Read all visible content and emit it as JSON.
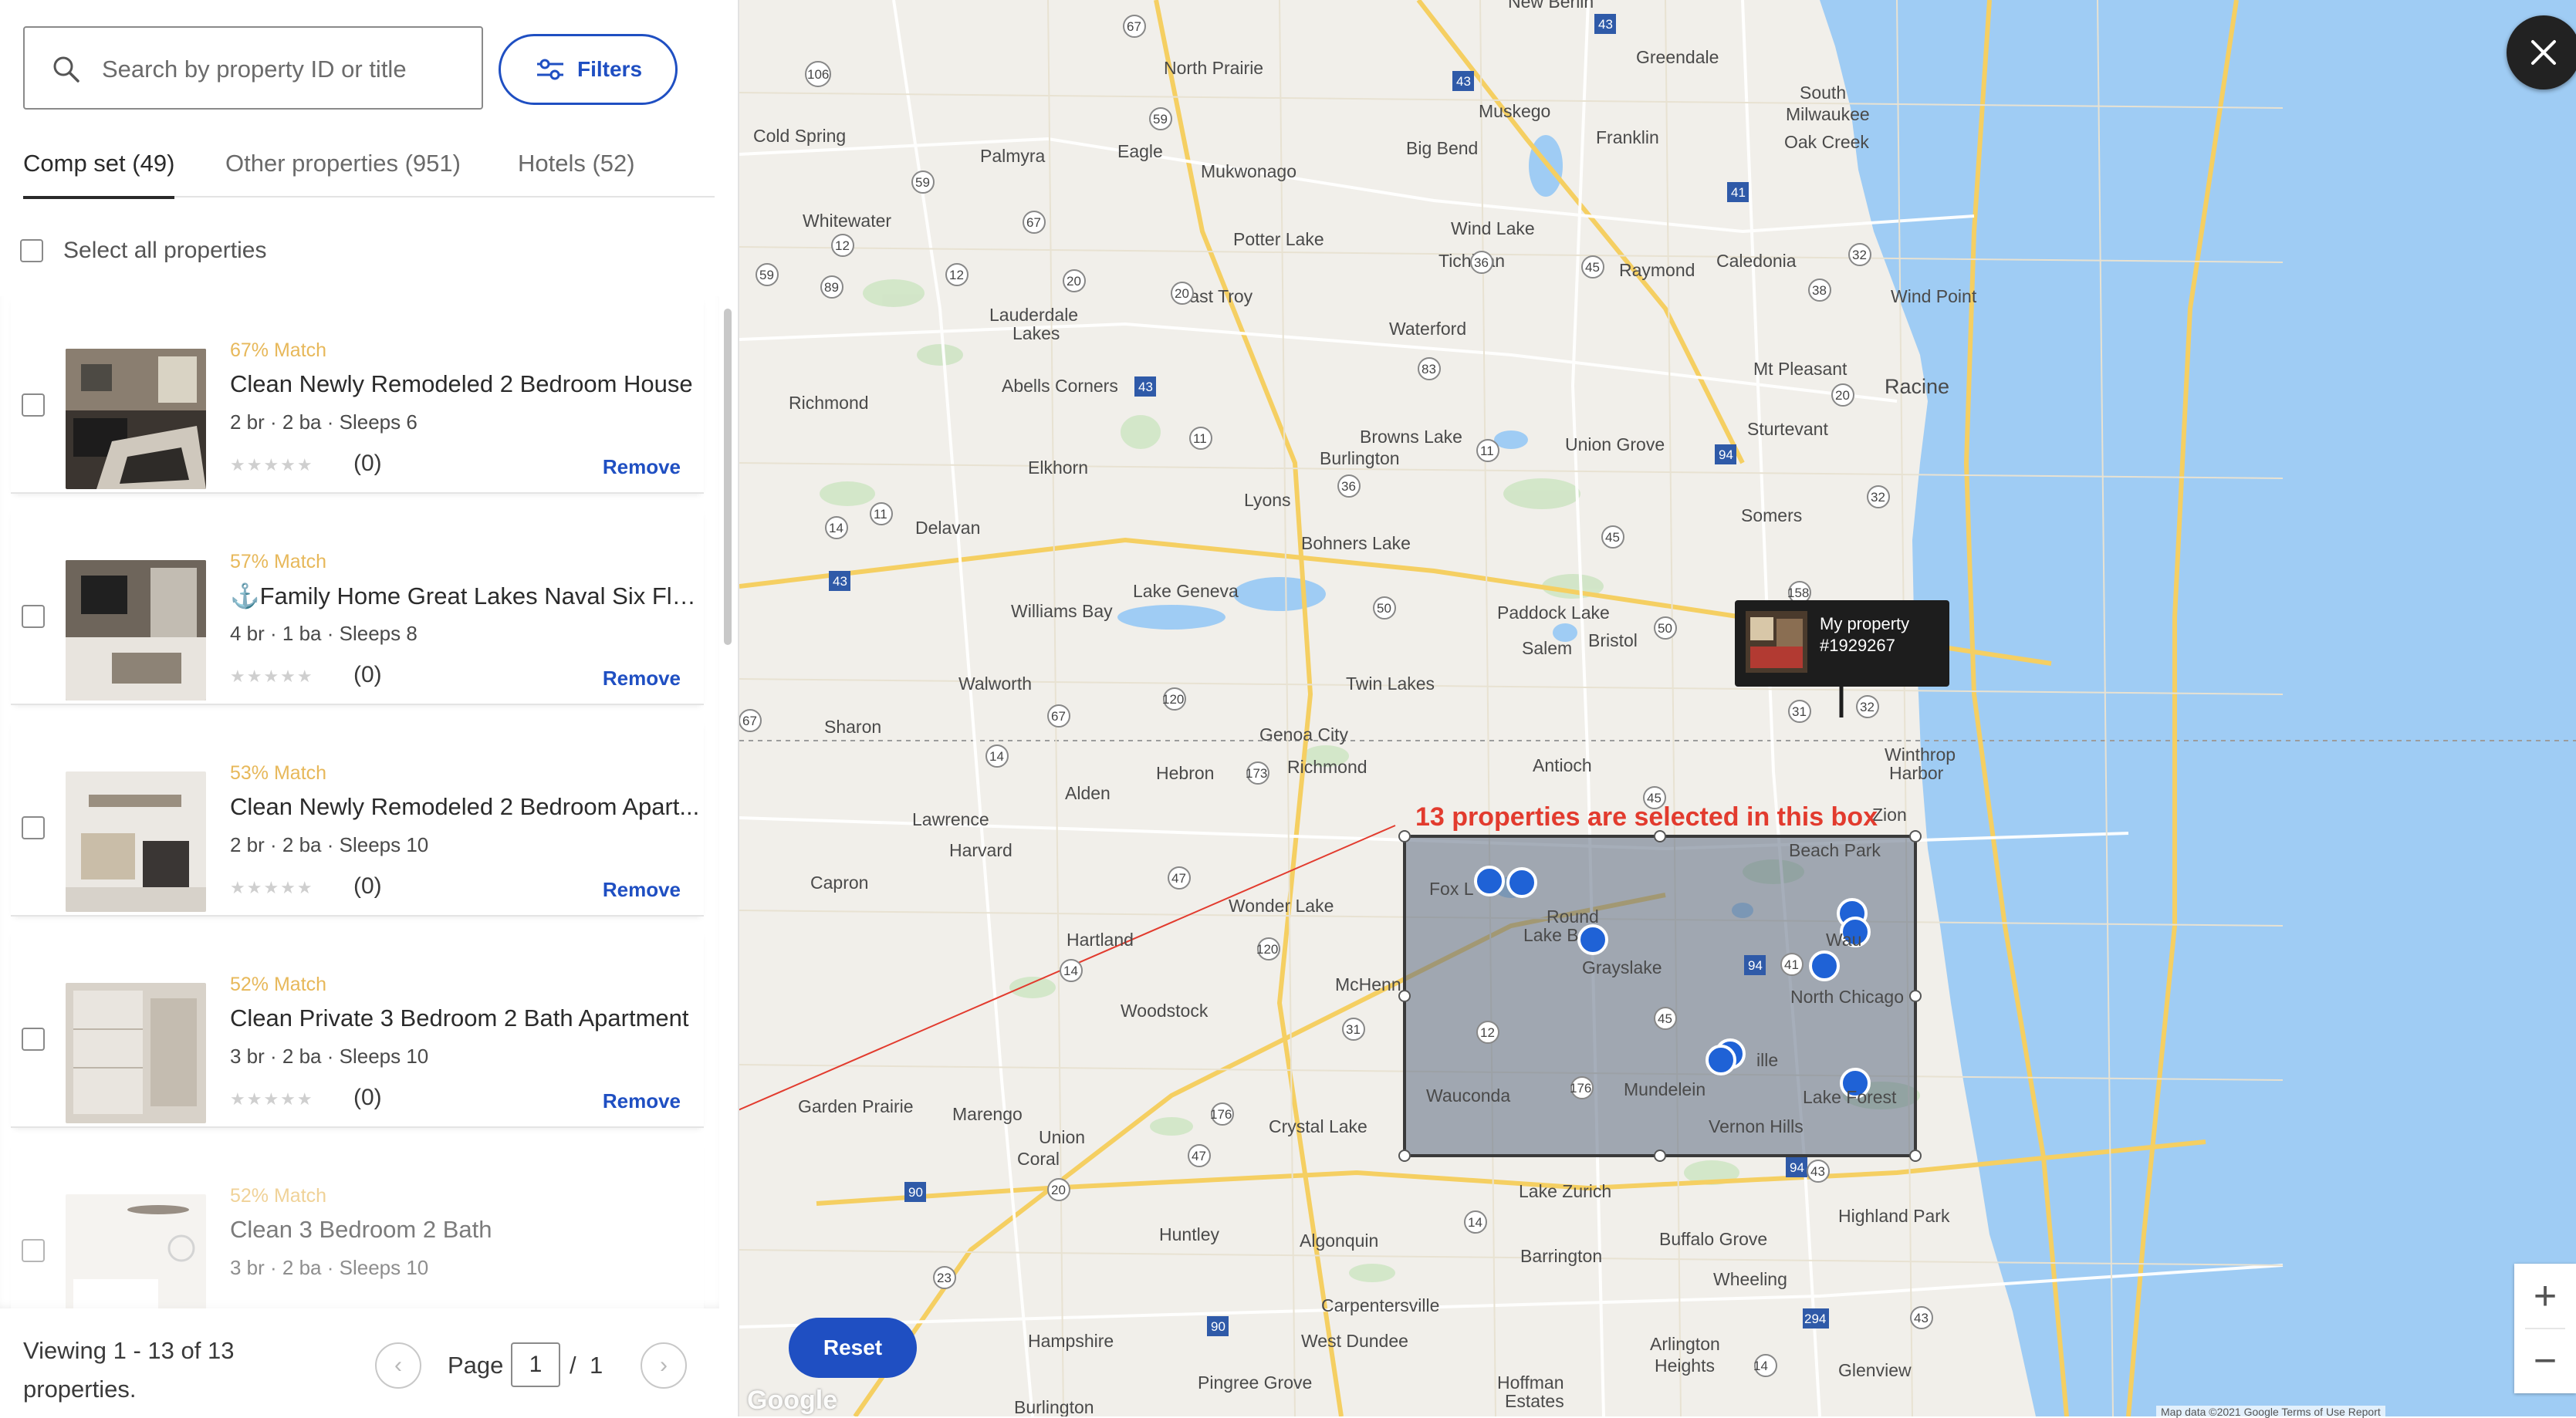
{
  "search": {
    "placeholder": "Search by property ID or title"
  },
  "filters": {
    "label": "Filters"
  },
  "tabs": [
    {
      "label": "Comp set (49)",
      "active": true
    },
    {
      "label": "Other properties (951)",
      "active": false
    },
    {
      "label": "Hotels (52)",
      "active": false
    }
  ],
  "select_all": {
    "label": "Select all properties"
  },
  "listings": [
    {
      "match": "67% Match",
      "title": "Clean Newly Remodeled 2 Bedroom House",
      "details": "2 br · 2 ba · Sleeps 6",
      "reviews": "(0)",
      "action": "Remove"
    },
    {
      "match": "57% Match",
      "title": "⚓Family Home Great Lakes Naval Six Flag...",
      "details": "4 br · 1 ba · Sleeps 8",
      "reviews": "(0)",
      "action": "Remove"
    },
    {
      "match": "53% Match",
      "title": "Clean Newly Remodeled 2 Bedroom Apart...",
      "details": "2 br · 2 ba · Sleeps 10",
      "reviews": "(0)",
      "action": "Remove"
    },
    {
      "match": "52% Match",
      "title": "Clean Private 3 Bedroom 2 Bath Apartment",
      "details": "3 br · 2 ba · Sleeps 10",
      "reviews": "(0)",
      "action": "Remove"
    },
    {
      "match": "52% Match",
      "title": "Clean 3 Bedroom 2 Bath",
      "details": "3 br · 2 ba · Sleeps 10",
      "reviews": "",
      "action": ""
    }
  ],
  "pagination": {
    "viewing": "Viewing 1 - 13 of 13 properties.",
    "page_label": "Page",
    "current_page": "1",
    "separator": "/",
    "total_pages": "1"
  },
  "map": {
    "reset_label": "Reset",
    "zoom_in": "+",
    "zoom_out": "−",
    "annotation": "13 properties are selected in this box",
    "popup": {
      "line1": "My property",
      "line2": "#1929267"
    },
    "google": "Google",
    "copyright": "Map data ©2021 Google   Terms of Use   Report",
    "places": [
      "North Prairie",
      "Greendale",
      "South Milwaukee",
      "Oak Creek",
      "Muskego",
      "Franklin",
      "Cold Spring",
      "Palmyra",
      "Eagle",
      "Big Bend",
      "Mukwonago",
      "Wind Lake",
      "Tichigan",
      "Raymond",
      "Caledonia",
      "Whitewater",
      "Potter Lake",
      "Wind Point",
      "East Troy",
      "Lauderdale Lakes",
      "Waterford",
      "Mt Pleasant",
      "Racine",
      "Abells Corners",
      "Richmond",
      "Sturtevant",
      "Browns Lake",
      "Burlington",
      "Union Grove",
      "Elkhorn",
      "Lyons",
      "Somers",
      "Delavan",
      "Bohners Lake",
      "Lake Geneva",
      "Williams Bay",
      "Paddock Lake",
      "Salem",
      "Bristol",
      "Twin Lakes",
      "Walworth",
      "Sharon",
      "Genoa City",
      "Winthrop Harbor",
      "Antioch",
      "Hebron",
      "Richmond",
      "Alden",
      "Lawrence",
      "Harvard",
      "Zion",
      "Beach Park",
      "Capron",
      "Fox Lake",
      "Round Lake Beach",
      "Waukegan",
      "Grayslake",
      "Wonder Lake",
      "Hartland",
      "North Chicago",
      "McHenry",
      "Libertyville",
      "Woodstock",
      "Wauconda",
      "Mundelein",
      "Lake Forest",
      "Garden Prairie",
      "Marengo",
      "Union",
      "Coral",
      "Crystal Lake",
      "Vernon Hills",
      "Lake Zurich",
      "Highland Park",
      "Huntley",
      "Algonquin",
      "Buffalo Grove",
      "Barrington",
      "Wheeling",
      "Hampshire",
      "Carpentersville",
      "West Dundee",
      "Arlington Heights",
      "Glenview",
      "Pingree Grove",
      "Hoffman Estates",
      "Burlington",
      "New Berlin"
    ]
  },
  "colors": {
    "accent": "#1f4fc2",
    "match": "#e7b85a",
    "annotation": "#e23b2e",
    "water": "#9fccf4",
    "land": "#f1efea"
  },
  "icons": [
    "search-icon",
    "sliders-icon",
    "close-icon",
    "chevron-left-icon",
    "chevron-right-icon",
    "star-icon",
    "anchor-icon"
  ]
}
